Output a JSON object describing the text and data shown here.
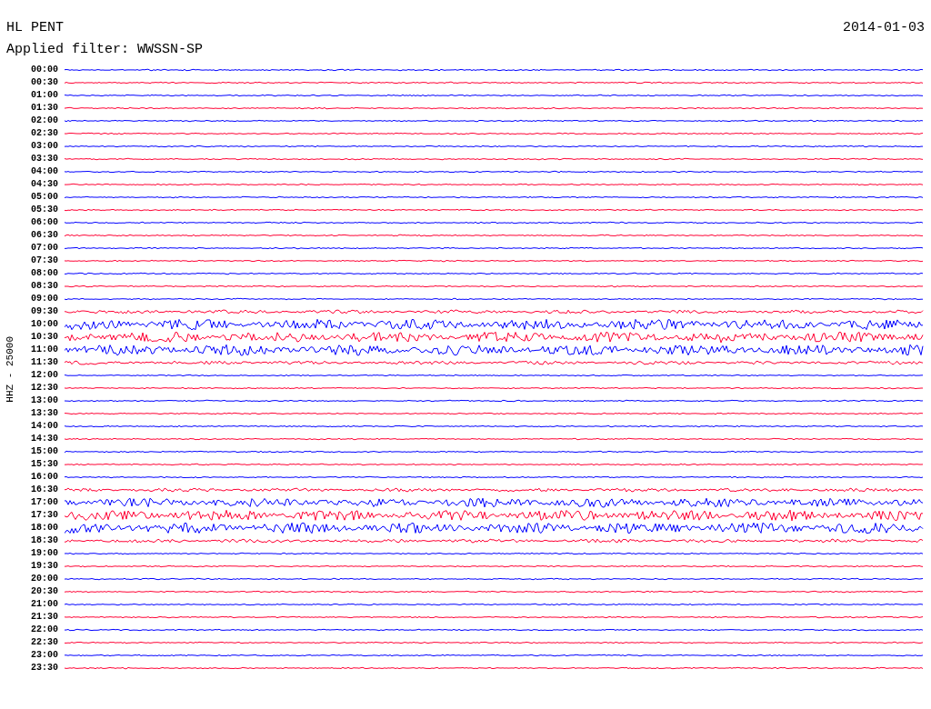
{
  "header": {
    "station": "HL PENT",
    "date": "2014-01-03",
    "filter": "Applied filter: WWSSN-SP"
  },
  "axis_label": "HHZ - 25000",
  "rows": [
    {
      "time": "00:00",
      "color": "#0000ff"
    },
    {
      "time": "00:30",
      "color": "#ff0033"
    },
    {
      "time": "01:00",
      "color": "#0000ff"
    },
    {
      "time": "01:30",
      "color": "#ff0033"
    },
    {
      "time": "02:00",
      "color": "#0000ff"
    },
    {
      "time": "02:30",
      "color": "#ff0033"
    },
    {
      "time": "03:00",
      "color": "#0000ff"
    },
    {
      "time": "03:30",
      "color": "#ff0033"
    },
    {
      "time": "04:00",
      "color": "#0000ff"
    },
    {
      "time": "04:30",
      "color": "#ff0033"
    },
    {
      "time": "05:00",
      "color": "#0000ff"
    },
    {
      "time": "05:30",
      "color": "#ff0033"
    },
    {
      "time": "06:00",
      "color": "#0000ff"
    },
    {
      "time": "06:30",
      "color": "#ff0033"
    },
    {
      "time": "07:00",
      "color": "#0000ff"
    },
    {
      "time": "07:30",
      "color": "#ff0033"
    },
    {
      "time": "08:00",
      "color": "#0000ff"
    },
    {
      "time": "08:30",
      "color": "#ff0033"
    },
    {
      "time": "09:00",
      "color": "#0000ff"
    },
    {
      "time": "09:30",
      "color": "#ff0033"
    },
    {
      "time": "10:00",
      "color": "#0000ff"
    },
    {
      "time": "10:30",
      "color": "#ff0033"
    },
    {
      "time": "11:00",
      "color": "#0000ff"
    },
    {
      "time": "11:30",
      "color": "#ff0033"
    },
    {
      "time": "12:00",
      "color": "#0000ff"
    },
    {
      "time": "12:30",
      "color": "#ff0033"
    },
    {
      "time": "13:00",
      "color": "#0000ff"
    },
    {
      "time": "13:30",
      "color": "#ff0033"
    },
    {
      "time": "14:00",
      "color": "#0000ff"
    },
    {
      "time": "14:30",
      "color": "#ff0033"
    },
    {
      "time": "15:00",
      "color": "#0000ff"
    },
    {
      "time": "15:30",
      "color": "#ff0033"
    },
    {
      "time": "16:00",
      "color": "#0000ff"
    },
    {
      "time": "16:30",
      "color": "#ff0033"
    },
    {
      "time": "17:00",
      "color": "#0000ff"
    },
    {
      "time": "17:30",
      "color": "#ff0033"
    },
    {
      "time": "18:00",
      "color": "#0000ff"
    },
    {
      "time": "18:30",
      "color": "#ff0033"
    },
    {
      "time": "19:00",
      "color": "#0000ff"
    },
    {
      "time": "19:30",
      "color": "#ff0033"
    },
    {
      "time": "20:00",
      "color": "#0000ff"
    },
    {
      "time": "20:30",
      "color": "#ff0033"
    },
    {
      "time": "21:00",
      "color": "#0000ff"
    },
    {
      "time": "21:30",
      "color": "#ff0033"
    },
    {
      "time": "22:00",
      "color": "#0000ff"
    },
    {
      "time": "22:30",
      "color": "#ff0033"
    },
    {
      "time": "23:00",
      "color": "#0000ff"
    },
    {
      "time": "23:30",
      "color": "#ff0033"
    }
  ]
}
